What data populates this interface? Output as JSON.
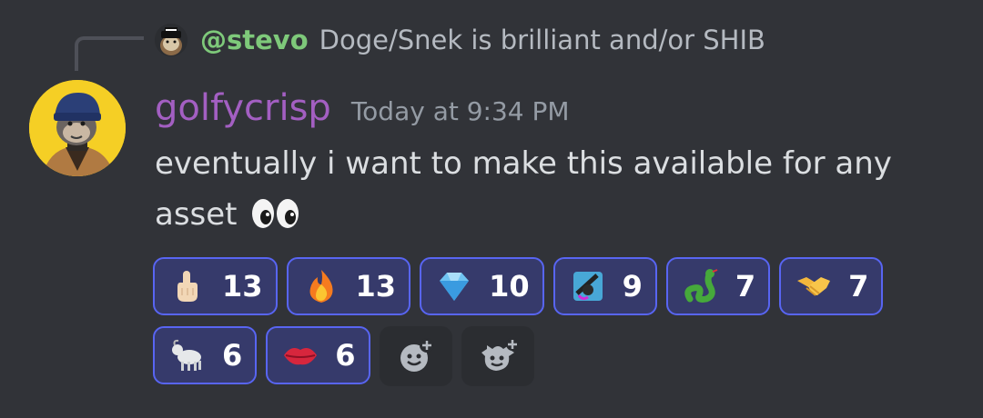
{
  "reply": {
    "username": "@stevo",
    "text": "Doge/Snek is brilliant and/or SHIB"
  },
  "message": {
    "username": "golfycrisp",
    "timestamp": "Today at 9:34 PM",
    "content": "eventually i want to make this available for any asset",
    "username_color": "#a35fc2"
  },
  "reactions": [
    {
      "emoji": "index-finger-up",
      "count": "13"
    },
    {
      "emoji": "fire",
      "count": "13"
    },
    {
      "emoji": "gem",
      "count": "10"
    },
    {
      "emoji": "custom-blue-creature",
      "count": "9"
    },
    {
      "emoji": "snake",
      "count": "7"
    },
    {
      "emoji": "handshake",
      "count": "7"
    },
    {
      "emoji": "goat",
      "count": "6"
    },
    {
      "emoji": "lips",
      "count": "6"
    }
  ],
  "add_reaction_buttons": [
    "add-reaction",
    "add-super-reaction"
  ],
  "colors": {
    "background": "#313338",
    "reaction_border": "#5865f2",
    "reaction_bg": "#363a6b",
    "reply_username": "#7ec97a"
  }
}
